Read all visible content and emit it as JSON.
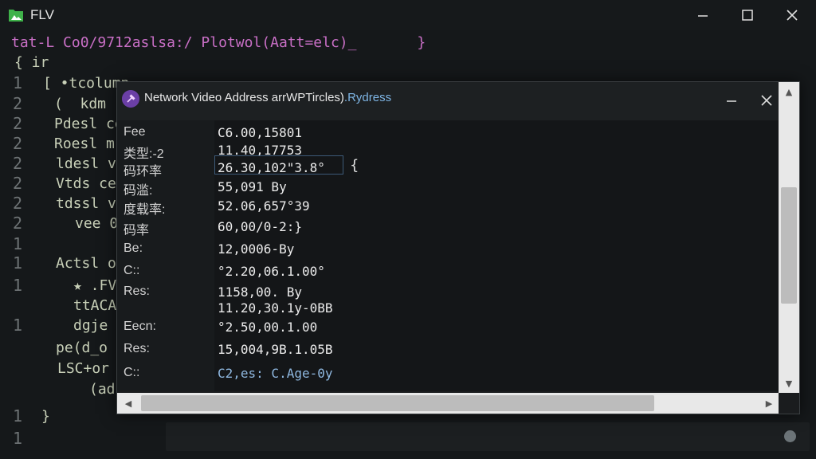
{
  "window": {
    "title": "FLV",
    "icon": "folder-app-icon",
    "accent": "#3fb24a"
  },
  "editor": {
    "lines": [
      {
        "gutter": "",
        "text": "tat-L Co0/9712aslsa:/ Plotwol(Aatt=elc)_       }"
      },
      {
        "gutter": "",
        "text": "{ ir"
      },
      {
        "gutter": "1",
        "text": "[ •tcolumn"
      },
      {
        "gutter": "2",
        "text": "(  kdm"
      },
      {
        "gutter": "2",
        "text": "Pdesl ce"
      },
      {
        "gutter": "2",
        "text": "Roesl m"
      },
      {
        "gutter": "2",
        "text": "ldesl ve"
      },
      {
        "gutter": "2",
        "text": "Vtds ce"
      },
      {
        "gutter": "2",
        "text": "tdssl v"
      },
      {
        "gutter": "2",
        "text": "vee 0"
      },
      {
        "gutter": "1",
        "text": ""
      },
      {
        "gutter": "1",
        "text": "Actsl o"
      },
      {
        "gutter": "1",
        "text": "★ .FV"
      },
      {
        "gutter": "",
        "text": "ttACA"
      },
      {
        "gutter": "1",
        "text": "dgje"
      },
      {
        "gutter": "",
        "text": "pe(d_o"
      },
      {
        "gutter": "",
        "text": "LSC+or"
      },
      {
        "gutter": "",
        "text": "(ad"
      },
      {
        "gutter": "1",
        "text": "}"
      },
      {
        "gutter": "1",
        "text": ""
      }
    ]
  },
  "dialog": {
    "title_main": "Network Video Address arrWPTircles)",
    "title_accent": ".Rydress",
    "icon": "pin-icon",
    "rows": [
      {
        "label": "Fee",
        "value": "C6.00,15801"
      },
      {
        "label": "类型:-2",
        "value": "11.40,17753"
      },
      {
        "label": "码环率",
        "value": "26.30,102\"3.8°"
      },
      {
        "label": "码滥:",
        "value": "55,091 By"
      },
      {
        "label": "度载率:",
        "value": "52.06,657°39"
      },
      {
        "label": "码率",
        "value": "60,00/0-2:}"
      },
      {
        "label": "Be:",
        "value": "12,0006-By"
      },
      {
        "label": "C::",
        "value": "°2.20,06.1.00°"
      },
      {
        "label": "Res:",
        "value": "1158,00. By"
      },
      {
        "label": "",
        "value": "11.20,30.1y-0BB"
      },
      {
        "label": "Eecn:",
        "value": "°2.50,00.1.00"
      },
      {
        "label": "Res:",
        "value": "15,004,9B.1.05B"
      },
      {
        "label": "C::",
        "value": "C2,es: C.Age-0y"
      }
    ],
    "caret": "{"
  },
  "colors": {
    "background": "#15181a",
    "dialog_bg": "#141618",
    "scrollbar": "#e8e8e8",
    "accent_text": "#7fb6e6"
  }
}
